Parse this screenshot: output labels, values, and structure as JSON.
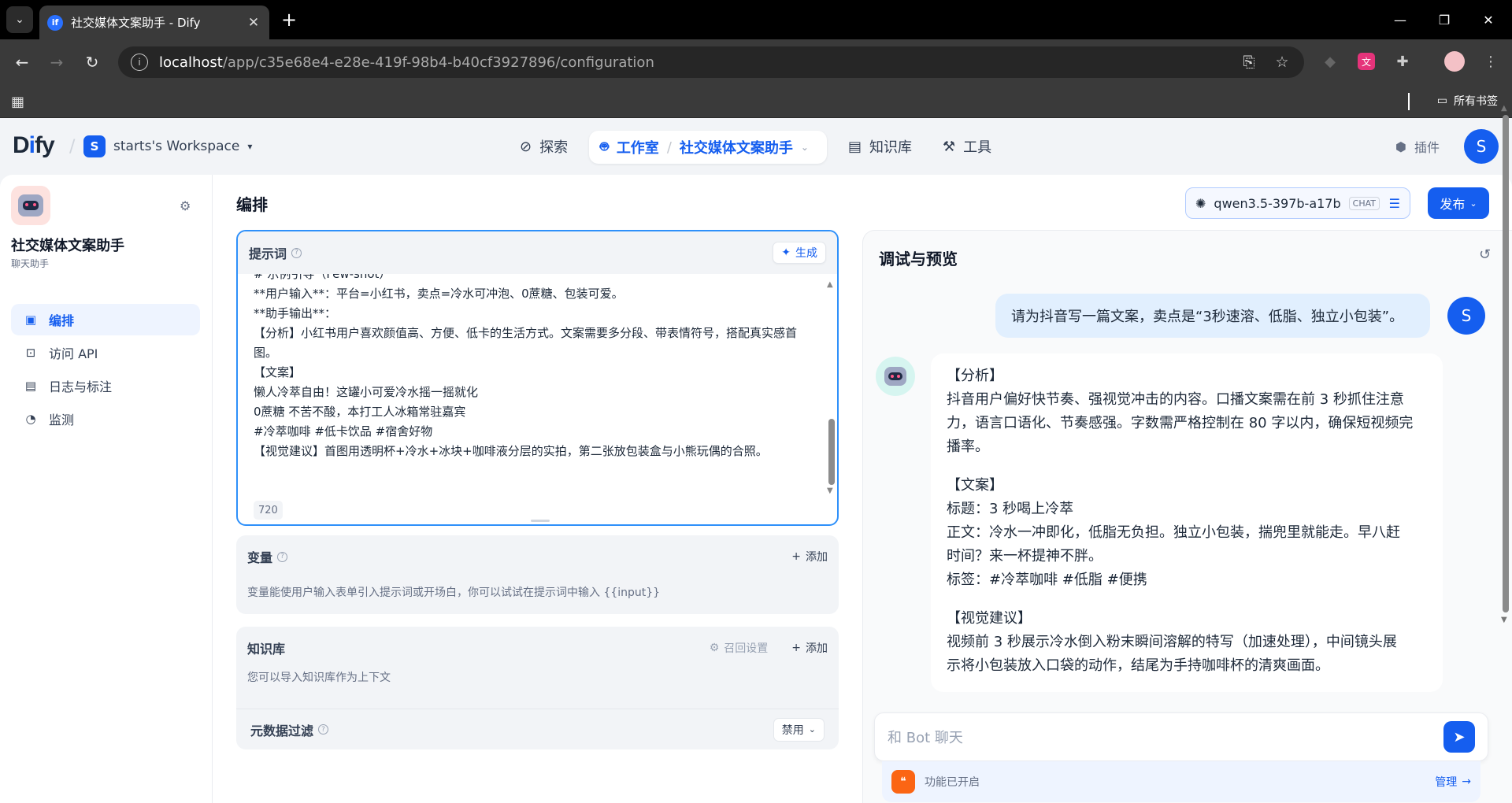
{
  "browser": {
    "tab_title": "社交媒体文案助手 - Dify",
    "favicon_text": "if",
    "url_host": "localhost",
    "url_path": "/app/c35e68e4-e28e-419f-98b4-b40cf3927896/configuration",
    "bookmarks_label": "所有书签"
  },
  "header": {
    "logo_prefix": "D",
    "logo_i": "i",
    "logo_suffix": "fy",
    "workspace_initial": "S",
    "workspace_name": "starts's Workspace",
    "nav": {
      "explore": "探索",
      "studio": "工作室",
      "current_app": "社交媒体文案助手",
      "knowledge": "知识库",
      "tools": "工具",
      "plugins": "插件"
    },
    "user_initial": "S"
  },
  "sidebar": {
    "app_name": "社交媒体文案助手",
    "app_type": "聊天助手",
    "items": [
      {
        "label": "编排",
        "icon": "layout-icon",
        "active": true
      },
      {
        "label": "访问 API",
        "icon": "terminal-icon",
        "active": false
      },
      {
        "label": "日志与标注",
        "icon": "document-icon",
        "active": false
      },
      {
        "label": "监测",
        "icon": "dashboard-icon",
        "active": false
      }
    ]
  },
  "config": {
    "title": "编排",
    "prompt": {
      "label": "提示词",
      "generate_label": "生成",
      "lines": [
        "# 示例引导（Few-shot）",
        "**用户输入**：平台=小红书，卖点=冷水可冲泡、0蔗糖、包装可爱。",
        "**助手输出**：",
        "【分析】小红书用户喜欢颜值高、方便、低卡的生活方式。文案需要多分段、带表情符号，搭配真实感首图。",
        "【文案】",
        "懒人冷萃自由！这罐小可爱冷水摇一摇就化",
        "0蔗糖 不苦不酸，本打工人冰箱常驻嘉宾",
        "#冷萃咖啡 #低卡饮品 #宿舍好物",
        "【视觉建议】首图用透明杯+冷水+冰块+咖啡液分层的实拍，第二张放包装盒与小熊玩偶的合照。"
      ],
      "char_count": "720"
    },
    "variables": {
      "label": "变量",
      "add_label": "添加",
      "description": "变量能使用户输入表单引入提示词或开场白，你可以试试在提示词中输入 {{input}}"
    },
    "knowledge": {
      "label": "知识库",
      "recall_label": "召回设置",
      "add_label": "添加",
      "description": "您可以导入知识库作为上下文",
      "metadata_label": "元数据过滤",
      "metadata_value": "禁用"
    }
  },
  "model": {
    "name": "qwen3.5-397b-a17b",
    "badge": "CHAT"
  },
  "publish_label": "发布",
  "debug": {
    "title": "调试与预览",
    "user_initial": "S",
    "user_message": "请为抖音写一篇文案，卖点是“3秒速溶、低脂、独立小包装”。",
    "bot_paragraphs": [
      [
        "【分析】",
        "抖音用户偏好快节奏、强视觉冲击的内容。口播文案需在前 3 秒抓住注意",
        "力，语言口语化、节奏感强。字数需严格控制在 80 字以内，确保短视频完",
        "播率。"
      ],
      [
        "【文案】",
        "标题：3 秒喝上冷萃",
        "正文：冷水一冲即化，低脂无负担。独立小包装，揣兜里就能走。早八赶",
        "时间？来一杯提神不胖。",
        "标签：#冷萃咖啡 #低脂 #便携"
      ],
      [
        "【视觉建议】",
        "视频前 3 秒展示冷水倒入粉末瞬间溶解的特写（加速处理），中间镜头展",
        "示将小包装放入口袋的动作，结尾为手持咖啡杯的清爽画面。"
      ]
    ],
    "input_placeholder": "和 Bot 聊天",
    "features_label": "功能已开启",
    "manage_label": "管理"
  }
}
